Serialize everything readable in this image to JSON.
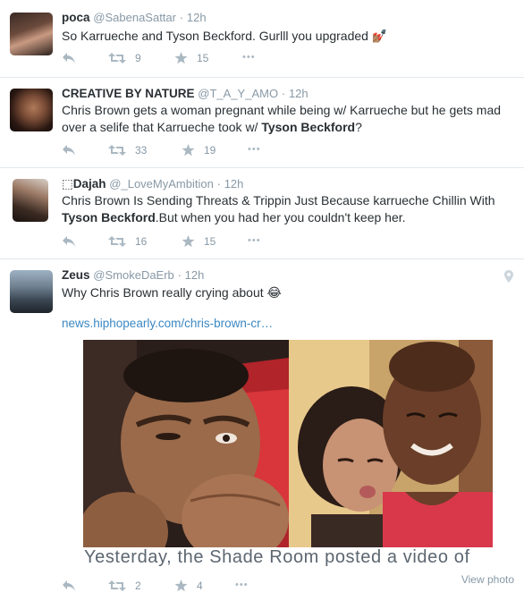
{
  "tweets": [
    {
      "name": "poca",
      "handle": "@SabenaSattar",
      "time": "12h",
      "text_html": "So Karrueche and Tyson Beckford. Gurlll you upgraded 💅🏽",
      "retweets": "9",
      "favorites": "15"
    },
    {
      "name": "CREATIVE BY NATURE",
      "handle": "@T_A_Y_AMO",
      "time": "12h",
      "line1": "Chris Brown gets a woman pregnant while being w/ Karrueche but he gets mad",
      "line2_pre": "over a selife that Karrueche took w/ ",
      "line2_bold": "Tyson Beckford",
      "line2_post": "?",
      "retweets": "33",
      "favorites": "19"
    },
    {
      "name": "⬚Dajah",
      "handle": "@_LoveMyAmbition",
      "time": "12h",
      "line1": "Chris Brown Is Sending Threats & Trippin Just Because karrueche Chillin With",
      "line2_bold": "Tyson Beckford",
      "line2_post": ".But when you had her you couldn't keep her.",
      "retweets": "16",
      "favorites": "15"
    },
    {
      "name": "Zeus",
      "handle": "@SmokeDaErb",
      "time": "12h",
      "text": "Why Chris Brown really crying about 😂",
      "link": "news.hiphopearly.com/chris-brown-cr…",
      "caption": "Yesterday, the Shade Room posted a video of",
      "view_photo": "View photo",
      "retweets": "2",
      "favorites": "4"
    }
  ],
  "dot": "·",
  "more_glyph": "•••",
  "colors": {
    "link": "#3b88c3",
    "meta": "#8899a6",
    "text": "#292f33",
    "divider": "#e1e8ed"
  },
  "icons": [
    "reply-icon",
    "retweet-icon",
    "favorite-icon",
    "more-icon",
    "location-pin-icon"
  ]
}
